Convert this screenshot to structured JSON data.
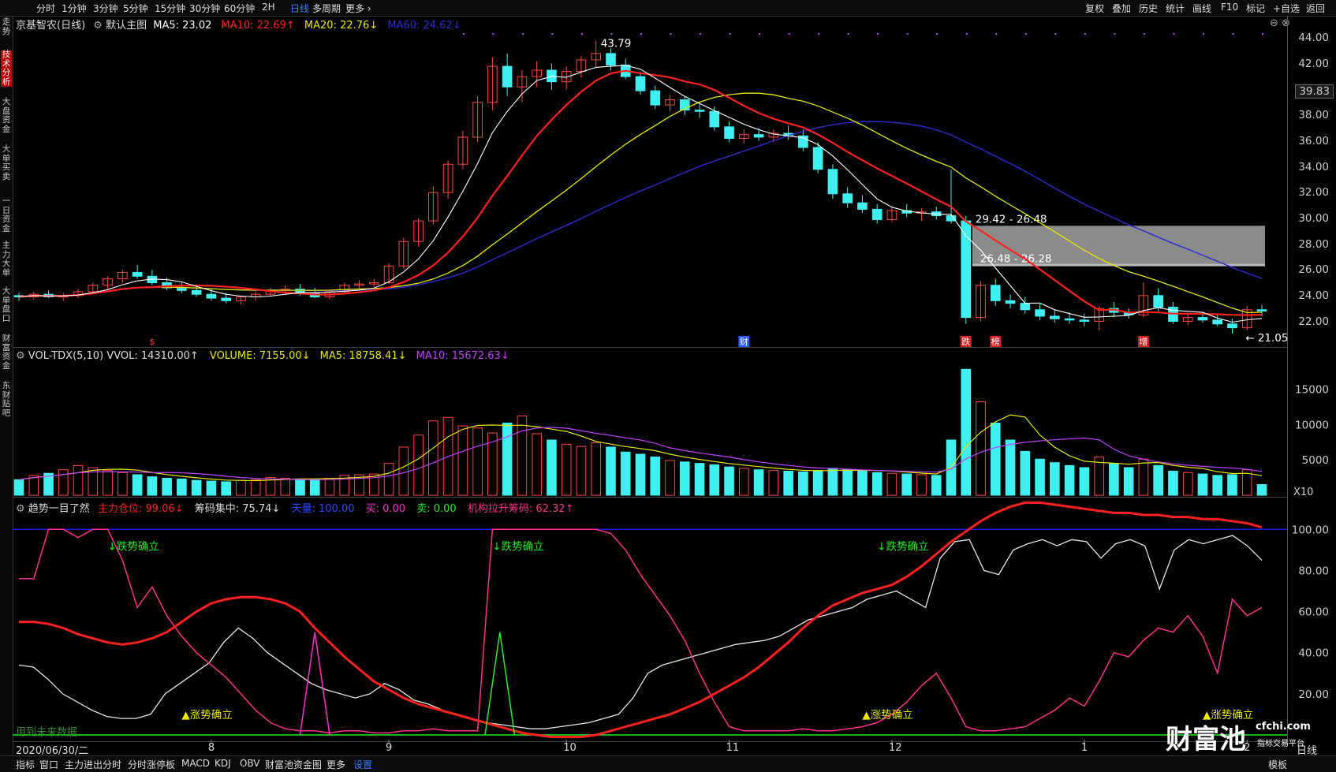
{
  "topbar": {
    "periods": [
      "分时",
      "1分钟",
      "3分钟",
      "5分钟",
      "15分钟",
      "30分钟",
      "60分钟",
      "2H",
      "日线",
      "多周期",
      "更多 ›"
    ],
    "active_period": "日线",
    "tools": [
      "复权",
      "叠加",
      "历史",
      "统计",
      "画线",
      "F10",
      "标记",
      "+自选",
      "返回"
    ]
  },
  "leftnav": [
    "分时走势",
    "技术分析",
    "大盘资金",
    "大单买卖",
    "一日资金",
    "主力大单",
    "大单盘口",
    "财富资金",
    "东财贴吧"
  ],
  "leftnav_active": "技术分析",
  "main_panel": {
    "stock": "京基智农(日线)",
    "template": "默认主图",
    "ma5": "MA5: 23.02",
    "ma10": "MA10: 22.69↑",
    "ma20": "MA20: 22.76↓",
    "ma60": "MA60: 24.62↓",
    "high_label": "43.79",
    "low_label": "21.05",
    "zone1": "29.42 - 26.48",
    "zone2": "26.48 - 26.28",
    "price_tag": "39.83",
    "y_ticks": [
      "44.00",
      "42.00",
      "40.00",
      "38.00",
      "36.00",
      "34.00",
      "32.00",
      "30.00",
      "28.00",
      "26.00",
      "24.00",
      "22.00"
    ],
    "markers": [
      "$",
      "财",
      "跌",
      "榜",
      "增"
    ]
  },
  "vol_panel": {
    "title": "VOL-TDX(5,10)",
    "vvol": "VVOL: 14310.00↑",
    "volume": "VOLUME: 7155.00↓",
    "ma5": "MA5: 18758.41↓",
    "ma10": "MA10: 15672.63↓",
    "y_ticks": [
      "15000",
      "10000",
      "5000"
    ],
    "unit": "X10"
  },
  "ind_panel": {
    "title": "趋势一目了然",
    "zhuli": "主力仓位: 99.06↓",
    "chouma": "筹码集中: 75.74↓",
    "tianwang": "天量: 100.00",
    "buy": "买: 0.00",
    "sell": "卖: 0.00",
    "jigou": "机构拉升筹码: 62.32↑",
    "y_ticks": [
      "100.00",
      "80.00",
      "60.00",
      "40.00",
      "20.00"
    ],
    "down_confirm": "↓跌势确立",
    "up_confirm": "▲涨势确立",
    "future_note": "用到未来数据"
  },
  "xaxis": {
    "date": "2020/06/30/二",
    "months": [
      "8",
      "9",
      "10",
      "11",
      "12",
      "1",
      "2"
    ],
    "right_label": "日线"
  },
  "bottombar": {
    "tabs": [
      "指标",
      "窗口",
      "主力进出分时",
      "分时涨停板",
      "MACD",
      "KDJ",
      "OBV",
      "财富池资金图",
      "更多",
      "设置"
    ],
    "active": "设置",
    "template_btn": "模板"
  },
  "watermark": {
    "brand": "财富池",
    "site": "cfchi.com",
    "sub": "指标交易平台"
  },
  "colors": {
    "up": "#ff4444",
    "down": "#3ff0f0",
    "ma5": "#ffffff",
    "ma10": "#ff2020",
    "ma20": "#e8e800",
    "ma60": "#2b2bd0",
    "vol_ma10": "#c040ff",
    "magenta": "#ff2f8e",
    "green": "#22ee22",
    "blue": "#2020ff"
  },
  "chart_data": {
    "type": "candlestick",
    "title": "京基智农(日线)",
    "ylim": [
      20.5,
      44.5
    ],
    "candles": [
      [
        24.0,
        24.2,
        23.6,
        23.9
      ],
      [
        23.9,
        24.3,
        23.7,
        24.1
      ],
      [
        24.1,
        24.4,
        23.8,
        23.9
      ],
      [
        23.9,
        24.2,
        23.6,
        24.0
      ],
      [
        24.0,
        24.5,
        23.8,
        24.3
      ],
      [
        24.3,
        25.0,
        24.1,
        24.8
      ],
      [
        24.8,
        25.5,
        24.5,
        25.3
      ],
      [
        25.3,
        26.0,
        25.0,
        25.8
      ],
      [
        25.8,
        26.4,
        25.3,
        25.5
      ],
      [
        25.5,
        26.0,
        24.8,
        25.0
      ],
      [
        25.0,
        25.4,
        24.4,
        24.6
      ],
      [
        24.6,
        25.0,
        24.2,
        24.4
      ],
      [
        24.4,
        24.8,
        23.9,
        24.1
      ],
      [
        24.1,
        24.5,
        23.6,
        23.8
      ],
      [
        23.8,
        24.2,
        23.4,
        23.6
      ],
      [
        23.6,
        24.0,
        23.3,
        23.9
      ],
      [
        23.9,
        24.3,
        23.6,
        24.1
      ],
      [
        24.1,
        24.6,
        23.9,
        24.4
      ],
      [
        24.4,
        24.8,
        24.1,
        24.5
      ],
      [
        24.5,
        24.9,
        24.0,
        24.2
      ],
      [
        24.2,
        24.6,
        23.8,
        23.9
      ],
      [
        23.9,
        24.4,
        23.7,
        24.3
      ],
      [
        24.3,
        25.0,
        24.1,
        24.8
      ],
      [
        24.8,
        25.2,
        24.4,
        24.9
      ],
      [
        24.9,
        25.3,
        24.6,
        25.0
      ],
      [
        25.0,
        26.5,
        24.9,
        26.3
      ],
      [
        26.3,
        28.5,
        26.1,
        28.2
      ],
      [
        28.2,
        30.0,
        27.8,
        29.8
      ],
      [
        29.8,
        32.5,
        29.5,
        32.0
      ],
      [
        32.0,
        34.5,
        31.5,
        34.2
      ],
      [
        34.2,
        36.8,
        33.8,
        36.3
      ],
      [
        36.3,
        39.5,
        35.9,
        39.0
      ],
      [
        39.0,
        42.5,
        38.4,
        41.8
      ],
      [
        41.8,
        42.8,
        39.5,
        40.2
      ],
      [
        40.2,
        41.5,
        39.0,
        41.0
      ],
      [
        41.0,
        42.2,
        40.2,
        41.5
      ],
      [
        41.5,
        42.0,
        40.0,
        40.6
      ],
      [
        40.6,
        41.8,
        40.0,
        41.4
      ],
      [
        41.4,
        42.6,
        40.9,
        42.3
      ],
      [
        42.3,
        43.79,
        41.7,
        42.8
      ],
      [
        42.8,
        43.2,
        41.5,
        41.9
      ],
      [
        41.9,
        42.4,
        40.8,
        41.0
      ],
      [
        41.0,
        41.4,
        39.6,
        39.9
      ],
      [
        39.9,
        40.3,
        38.5,
        38.8
      ],
      [
        38.8,
        39.6,
        38.3,
        39.2
      ],
      [
        39.2,
        39.5,
        38.0,
        38.4
      ],
      [
        38.4,
        38.9,
        37.8,
        38.3
      ],
      [
        38.3,
        38.7,
        36.8,
        37.1
      ],
      [
        37.1,
        37.5,
        35.9,
        36.2
      ],
      [
        36.2,
        36.9,
        35.8,
        36.5
      ],
      [
        36.5,
        37.0,
        36.0,
        36.3
      ],
      [
        36.3,
        36.9,
        35.9,
        36.6
      ],
      [
        36.6,
        37.2,
        36.1,
        36.4
      ],
      [
        36.4,
        36.9,
        35.2,
        35.5
      ],
      [
        35.5,
        35.9,
        33.5,
        33.8
      ],
      [
        33.8,
        34.2,
        31.5,
        31.9
      ],
      [
        31.9,
        32.4,
        30.8,
        31.2
      ],
      [
        31.2,
        31.8,
        30.4,
        30.7
      ],
      [
        30.7,
        31.1,
        29.6,
        29.9
      ],
      [
        29.9,
        30.9,
        29.7,
        30.6
      ],
      [
        30.6,
        31.1,
        30.1,
        30.4
      ],
      [
        30.4,
        30.8,
        29.8,
        30.5
      ],
      [
        30.5,
        30.9,
        29.9,
        30.2
      ],
      [
        30.2,
        33.8,
        29.6,
        29.8
      ],
      [
        29.8,
        30.2,
        21.8,
        22.3
      ],
      [
        22.3,
        25.1,
        22.0,
        24.8
      ],
      [
        24.8,
        25.3,
        23.2,
        23.6
      ],
      [
        23.6,
        24.1,
        23.0,
        23.4
      ],
      [
        23.4,
        23.9,
        22.6,
        22.9
      ],
      [
        22.9,
        23.4,
        22.1,
        22.4
      ],
      [
        22.4,
        22.9,
        21.9,
        22.2
      ],
      [
        22.2,
        22.7,
        21.8,
        22.1
      ],
      [
        22.1,
        22.6,
        21.6,
        22.0
      ],
      [
        22.0,
        23.2,
        21.3,
        23.0
      ],
      [
        23.0,
        23.5,
        22.3,
        22.7
      ],
      [
        22.7,
        23.0,
        22.2,
        22.5
      ],
      [
        22.5,
        25.0,
        22.3,
        24.0
      ],
      [
        24.0,
        24.6,
        22.8,
        23.1
      ],
      [
        23.1,
        23.5,
        21.8,
        22.0
      ],
      [
        22.0,
        22.6,
        21.7,
        22.3
      ],
      [
        22.3,
        22.7,
        21.9,
        22.1
      ],
      [
        22.1,
        22.5,
        21.6,
        21.8
      ],
      [
        21.8,
        22.2,
        21.05,
        21.5
      ],
      [
        21.5,
        23.2,
        21.3,
        22.9
      ],
      [
        22.9,
        23.3,
        22.4,
        22.8
      ]
    ],
    "volume": [
      2200,
      2800,
      3100,
      3600,
      4200,
      3900,
      3500,
      3200,
      2900,
      2600,
      2400,
      2300,
      2100,
      2000,
      1900,
      2100,
      2200,
      2500,
      2400,
      2300,
      2200,
      2400,
      2800,
      2900,
      3000,
      4500,
      6800,
      8500,
      10500,
      11000,
      9800,
      9500,
      8800,
      10200,
      11200,
      8700,
      7800,
      7200,
      6900,
      7400,
      6800,
      6100,
      5800,
      5400,
      4900,
      4700,
      4500,
      4300,
      4000,
      3800,
      3600,
      3500,
      3400,
      3300,
      3500,
      3800,
      3600,
      3400,
      3200,
      3100,
      3000,
      2900,
      2800,
      7800,
      17800,
      13200,
      10200,
      7800,
      6200,
      5100,
      4600,
      4200,
      3900,
      5400,
      4500,
      3900,
      5100,
      4200,
      3400,
      3200,
      3000,
      2800,
      2900,
      3600,
      1500
    ],
    "series": [
      {
        "name": "主力仓位",
        "values": [
          99.06
        ]
      },
      {
        "name": "筹码集中",
        "values": [
          75.74
        ]
      },
      {
        "name": "天量",
        "values": [
          100.0
        ]
      },
      {
        "name": "机构拉升筹码",
        "values": [
          62.32
        ]
      }
    ]
  }
}
